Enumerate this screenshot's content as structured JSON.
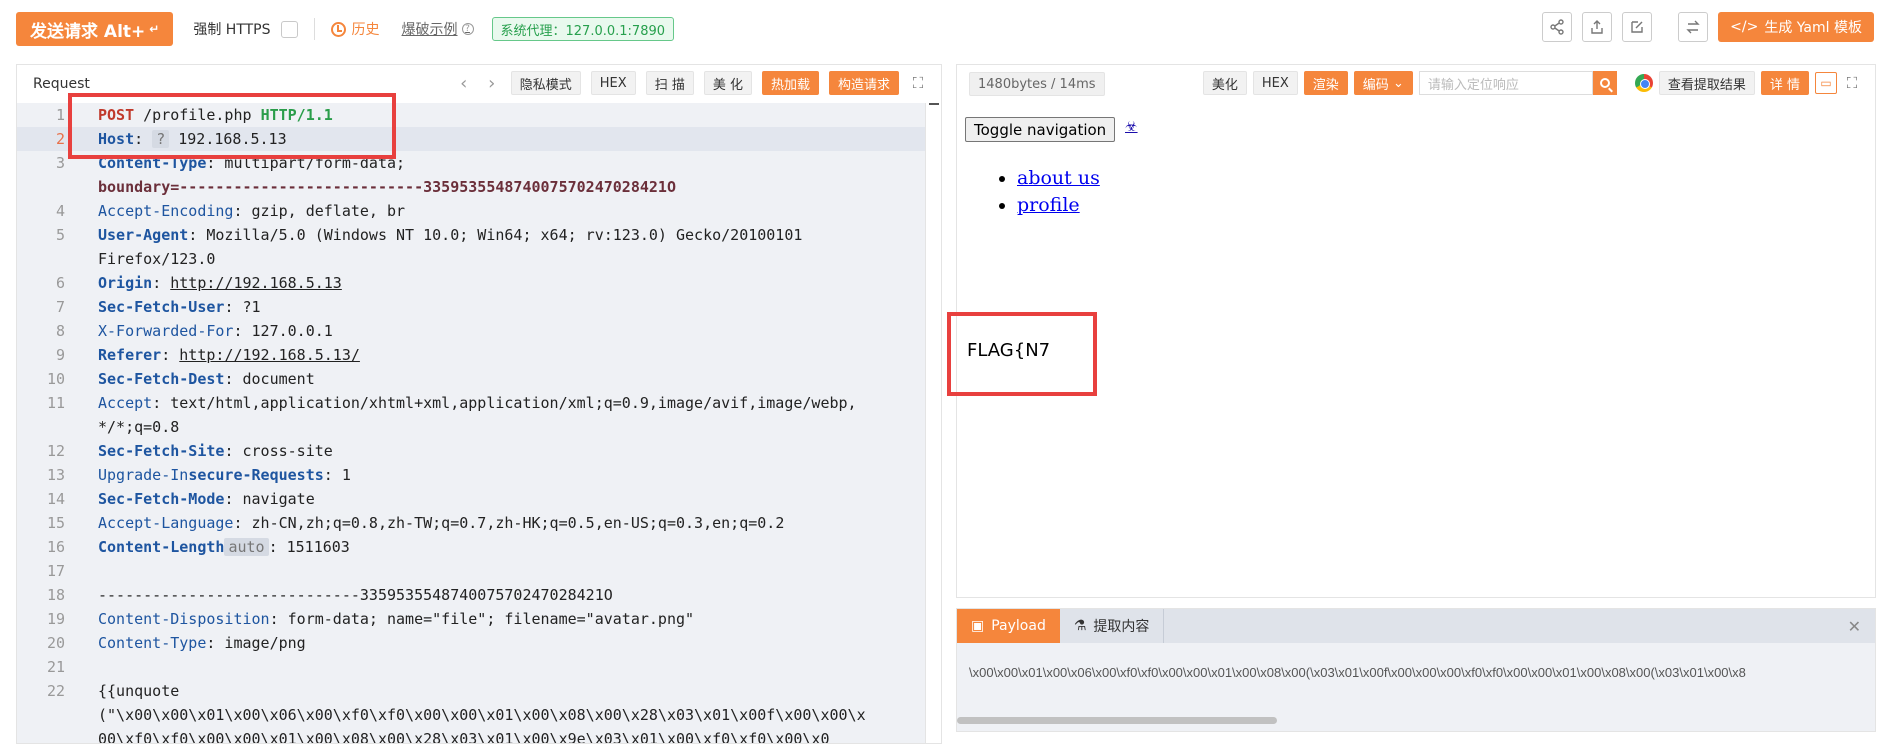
{
  "toolbar": {
    "send_label": "发送请求 Alt+",
    "send_icon": "return-icon",
    "force_https_label": "强制 HTTPS",
    "history_label": "历史",
    "examples_label": "爆破示例",
    "proxy_label": "系统代理：127.0.0.1:7890",
    "yaml_label": "生成 Yaml 模板",
    "right_icons": [
      "share-icon",
      "export-icon",
      "edit-icon",
      "swap-icon",
      "code-icon"
    ]
  },
  "request": {
    "title": "Request",
    "nav_prev": "‹",
    "nav_next": "›",
    "buttons": {
      "privacy": "隐私模式",
      "hex": "HEX",
      "scan": "扫 描",
      "beautify": "美 化",
      "hotload": "热加载",
      "construct": "构造请求"
    },
    "line_numbers": [
      "1",
      "2",
      "3",
      "",
      "4",
      "5",
      "",
      "6",
      "7",
      "8",
      "9",
      "10",
      "11",
      "",
      "12",
      "13",
      "14",
      "15",
      "16",
      "17",
      "18",
      "19",
      "20",
      "21",
      "22",
      ""
    ],
    "lines": {
      "l1_method": "POST",
      "l1_path": " /profile.php ",
      "l1_version": "HTTP/1.1",
      "l2_key": "Host",
      "l2_tag": "?",
      "l2_val": " 192.168.5.13",
      "l3_key": "Content-Type",
      "l3_val": ": multipart/form-data; ",
      "l3b_val": "boundary=---------------------------335953554874007570247028421O",
      "l4_key": "Accept-Encoding",
      "l4_val": ": gzip, deflate, br",
      "l5_key": "User-Agent",
      "l5_val": ": Mozilla/5.0 (Windows NT 10.0; Win64; x64; rv:123.0) Gecko/20100101 ",
      "l5b_val": "Firefox/123.0",
      "l6_key": "Origin",
      "l6_sep": ": ",
      "l6_val": "http://192.168.5.13",
      "l7_key": "Sec-Fetch-User",
      "l7_val": ": ?1",
      "l8_key": "X-Forwarded-For",
      "l8_val": ": 127.0.0.1",
      "l9_key": "Referer",
      "l9_sep": ": ",
      "l9_val": "http://192.168.5.13/",
      "l10_key": "Sec-Fetch-Dest",
      "l10_val": ": document",
      "l11_key": "Accept",
      "l11_val": ": text/html,application/xhtml+xml,application/xml;q=0.9,image/avif,image/webp,",
      "l11b_val": "*/*;q=0.8",
      "l12_key": "Sec-Fetch-Site",
      "l12_val": ": cross-site",
      "l13_key_a": "Upgrade-In",
      "l13_key_b": "secure-Requests",
      "l13_val": ": 1",
      "l14_key": "Sec-Fetch-Mode",
      "l14_val": ": navigate",
      "l15_key": "Accept-Language",
      "l15_val": ": zh-CN,zh;q=0.8,zh-TW;q=0.7,zh-HK;q=0.5,en-US;q=0.3,en;q=0.2",
      "l16_key": "Content-Length",
      "l16_tag": "auto",
      "l16_val": ": 1511603",
      "l18_val": "-----------------------------335953554874007570247028421O",
      "l19_key": "Content-Disposition",
      "l19_val": ": form-data; name=\"file\"; filename=\"avatar.png\"",
      "l20_key": "Content-Type",
      "l20_val": ": image/png",
      "l22_val": "{{unquote",
      "l22b_val": "(\"\\x00\\x00\\x01\\x00\\x06\\x00\\xf0\\xf0\\x00\\x00\\x01\\x00\\x08\\x00\\x28\\x03\\x01\\x00f\\x00\\x00\\x",
      "l22c_val": "00\\xf0\\xf0\\x00\\x00\\x01\\x00\\x08\\x00\\x28\\x03\\x01\\x00\\x9e\\x03\\x01\\x00\\xf0\\xf0\\x00\\x0"
    }
  },
  "response": {
    "size_time": "1480bytes / 14ms",
    "buttons": {
      "beautify": "美化",
      "hex": "HEX",
      "render": "渲染",
      "encode": "编码",
      "view_extract": "查看提取结果",
      "detail": "详 情"
    },
    "search_placeholder": "请输入定位响应",
    "render": {
      "toggle_nav": "Toggle navigation",
      "bio_glyph": "☣",
      "nav_items": [
        "about us",
        "profile"
      ],
      "flag_text": "FLAG{N7"
    }
  },
  "payload_panel": {
    "tabs": [
      "Payload",
      "提取内容"
    ],
    "close_glyph": "✕",
    "content": "\\x00\\x00\\x01\\x00\\x06\\x00\\xf0\\xf0\\x00\\x00\\x01\\x00\\x08\\x00(\\x03\\x01\\x00f\\x00\\x00\\x00\\xf0\\xf0\\x00\\x00\\x01\\x00\\x08\\x00(\\x03\\x01\\x00\\x8"
  },
  "colors": {
    "accent": "#f5863c",
    "annotation": "#e8403e",
    "proxy_green": "#27a04d",
    "header_key": "#1e55a0",
    "method_red": "#c0392b"
  }
}
